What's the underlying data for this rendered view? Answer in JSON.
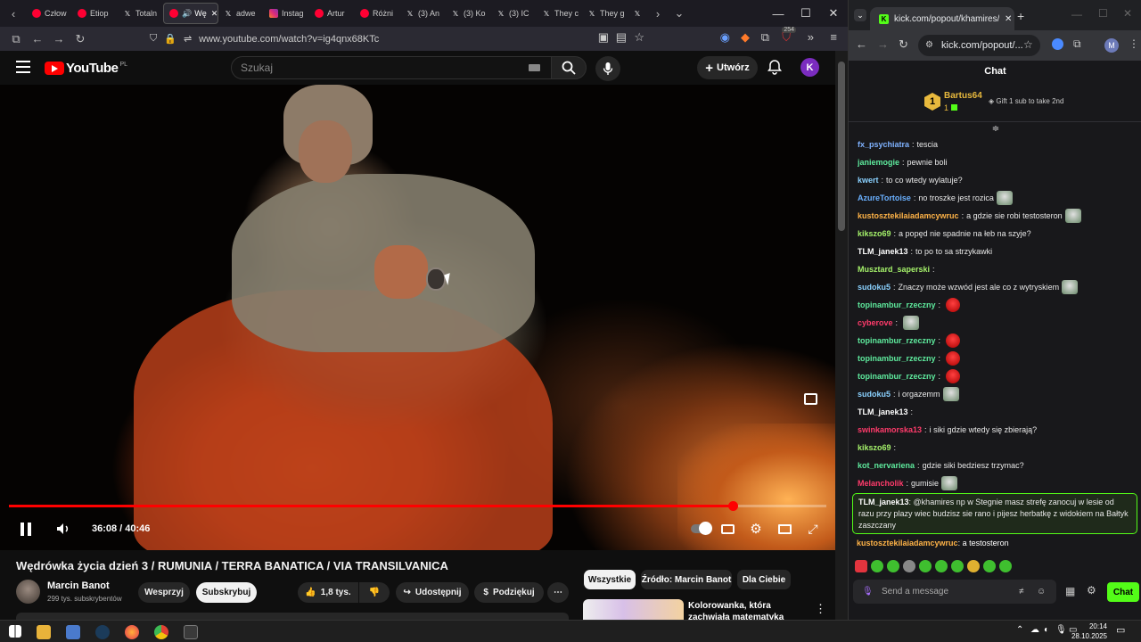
{
  "firefox": {
    "tabs": [
      "Człow",
      "Etiop",
      "Totaln",
      "Wę",
      "adwe",
      "Instag",
      "Artur",
      "Różni",
      "(3) An",
      "(3) Ko",
      "(3) IC",
      "They c",
      "They g"
    ],
    "url": "www.youtube.com/watch?v=ig4qnx68KTc",
    "notif_badge": "254"
  },
  "youtube": {
    "logo_text": "YouTube",
    "region": "PL",
    "search_placeholder": "Szukaj",
    "create_label": "Utwórz",
    "avatar_letter": "K",
    "time_current": "36:08",
    "time_separator": "/",
    "time_total": "40:46",
    "progress_fraction": 0.886,
    "video_title": "Wędrówka życia dzień 3 / RUMUNIA / TERRA BANATICA / VIA TRANSILVANICA",
    "channel_name": "Marcin Banot",
    "channel_subs": "299 tys. subskrybentów",
    "support_label": "Wesprzyj",
    "subscribe_label": "Subskrybuj",
    "likes_label": "1,8 tys.",
    "share_label": "Udostępnij",
    "thanks_label": "Podziękuj",
    "chips": [
      "Wszystkie",
      "Źródło: Marcin Banot",
      "Dla Ciebie"
    ],
    "reco_title": "Kolorowanka, która zachwiała matematyką"
  },
  "chrome": {
    "tab_title": "kick.com/popout/khamires/cha",
    "url": "kick.com/popout/...",
    "profile_letter": "M"
  },
  "chat": {
    "title": "Chat",
    "pinned_user": "Bartus64",
    "pinned_rank": "1",
    "pinned_count": "1",
    "pinned_msg": "Gift 1 sub to take 2nd",
    "messages": [
      {
        "user": "fx_psychiatra",
        "color": "#7fb2ff",
        "text": "tescia",
        "emote": "face",
        "emote_before": true
      },
      {
        "user": "janiemogie",
        "color": "#5eea9d",
        "text": "pewnie boli",
        "emote": ""
      },
      {
        "user": "kwert",
        "color": "#8ad1ff",
        "text": "to co wtedy wylatuje?",
        "emote": ""
      },
      {
        "user": "AzureTortoise",
        "color": "#6ab0ff",
        "text": "no troszke jest rozica",
        "emote": "frog"
      },
      {
        "user": "kustosztekilaiadamcywruc",
        "color": "#ffb347",
        "text": "a gdzie sie robi testosteron",
        "emote": "frog"
      },
      {
        "user": "kikszo69",
        "color": "#a4f06a",
        "text": "a popęd nie spadnie na łeb na szyje?",
        "emote": ""
      },
      {
        "user": "TLM_janek13",
        "color": "#ffffff",
        "text": "to po to sa strzykawki",
        "emote": ""
      },
      {
        "user": "Musztard_saperski",
        "color": "#a4f06a",
        "text": "",
        "emote": "face"
      },
      {
        "user": "sudoku5",
        "color": "#8ad1ff",
        "text": "Znaczy może wzwód jest ale co z wytryskiem",
        "emote": "frog"
      },
      {
        "user": "topinambur_rzeczny",
        "color": "#5eea9d",
        "text": "",
        "emote": "red"
      },
      {
        "user": "cyberove",
        "color": "#ff3b6b",
        "text": "",
        "emote": "frog"
      },
      {
        "user": "topinambur_rzeczny",
        "color": "#5eea9d",
        "text": "",
        "emote": "red"
      },
      {
        "user": "topinambur_rzeczny",
        "color": "#5eea9d",
        "text": "",
        "emote": "red"
      },
      {
        "user": "topinambur_rzeczny",
        "color": "#5eea9d",
        "text": "",
        "emote": "red"
      },
      {
        "user": "sudoku5",
        "color": "#8ad1ff",
        "text": "i orgazemm",
        "emote": "frog"
      },
      {
        "user": "TLM_janek13",
        "color": "#ffffff",
        "text": "",
        "emote": "face"
      },
      {
        "user": "swinkamorska13",
        "color": "#ff3b6b",
        "text": "i siki gdzie wtedy się zbierają?",
        "emote": ""
      },
      {
        "user": "kikszo69",
        "color": "#a4f06a",
        "text": "",
        "emote": "face"
      },
      {
        "user": "kot_nervariena",
        "color": "#5eea9d",
        "text": "gdzie siki bedziesz trzymac?",
        "emote": ""
      },
      {
        "user": "Melancholik",
        "color": "#ff3b6b",
        "text": "gumisie",
        "emote": "frog"
      }
    ],
    "highlight": {
      "user": "TLM_janek13",
      "text": "@khamires np w Stegnie masz strefę zanocuj w lesie od razu przy plazy wiec budzisz sie rano i pijesz herbatkę z widokiem na Bałtyk zaszczany"
    },
    "last_message": {
      "user": "kustosztekilaiadamcywruc",
      "text": "a testosteron"
    },
    "send_placeholder": "Send a message",
    "chat_button": "Chat"
  },
  "taskbar": {
    "time": "20:14",
    "date": "28.10.2025"
  }
}
